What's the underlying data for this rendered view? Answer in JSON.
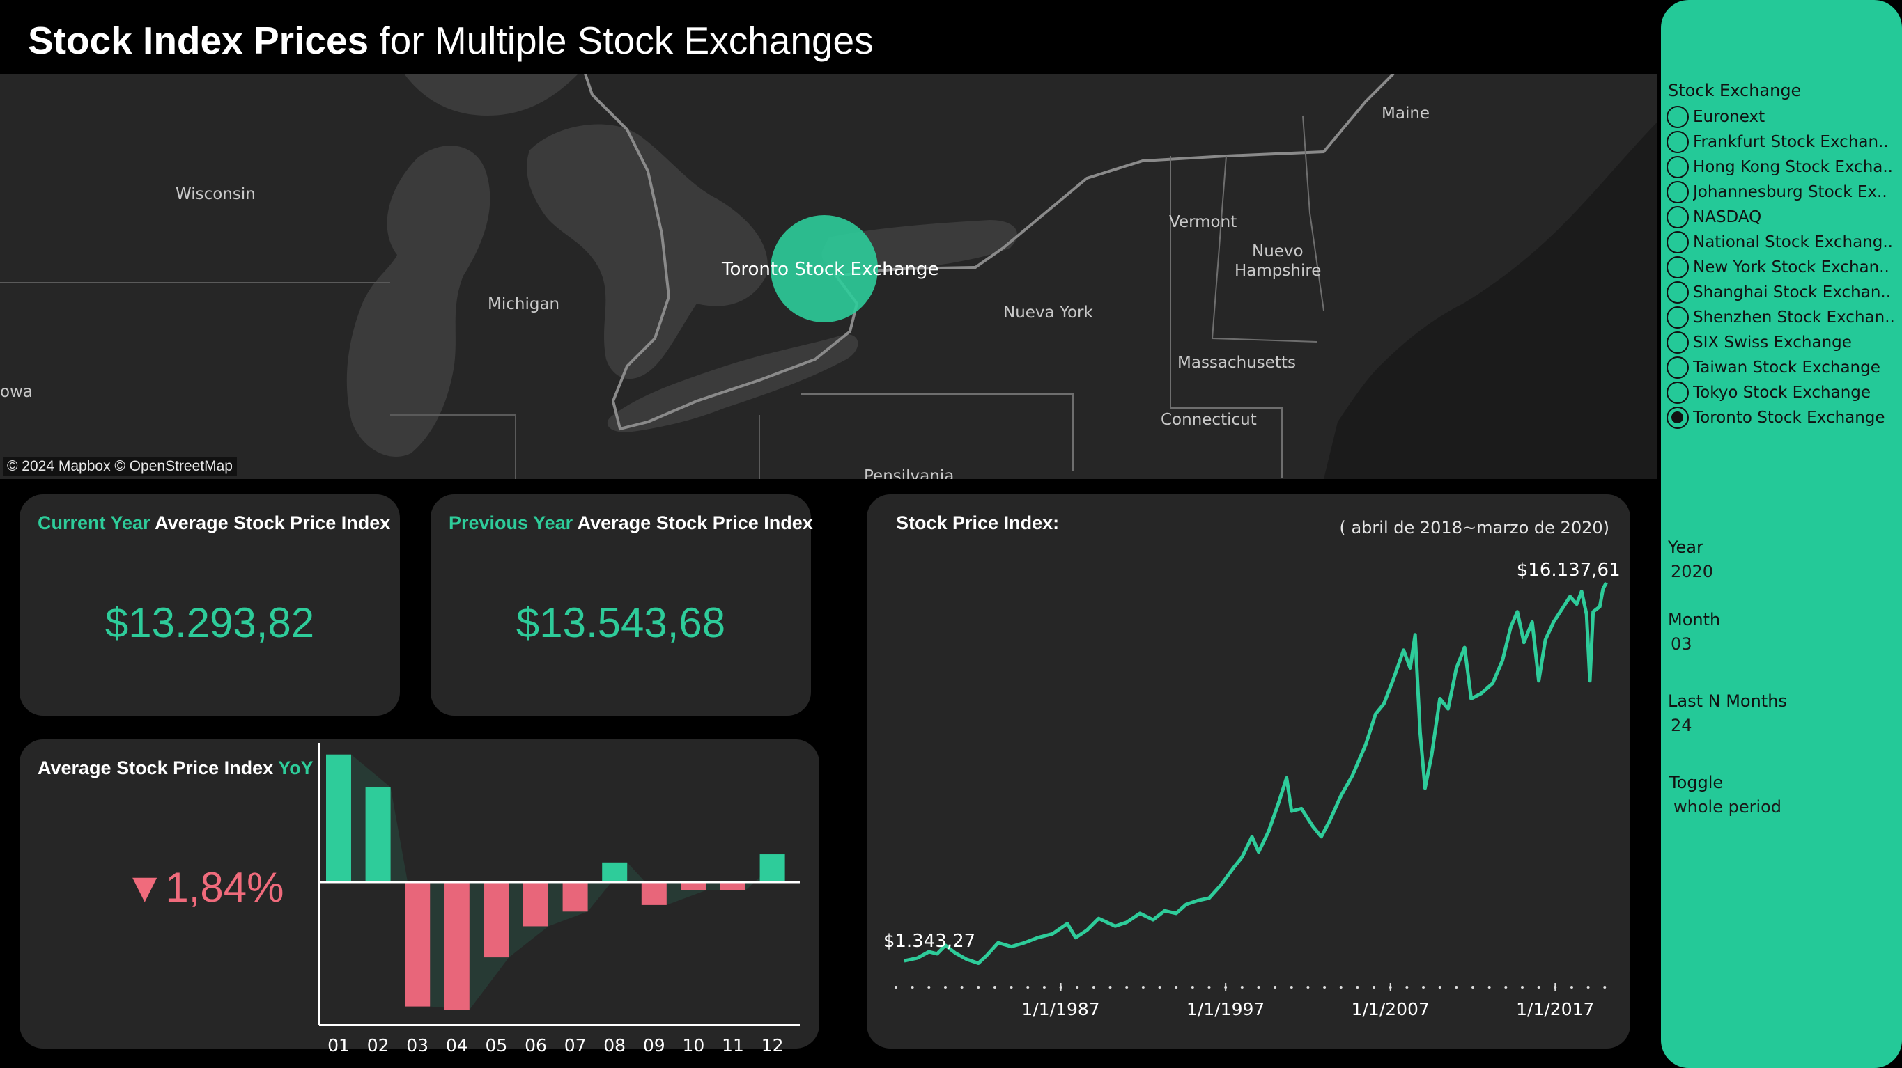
{
  "title": {
    "bold": "Stock Index Prices",
    "rest": "for Multiple Stock Exchanges"
  },
  "map": {
    "places": {
      "wisconsin": "Wisconsin",
      "michigan": "Michigan",
      "iowa": "owa",
      "maine": "Maine",
      "vermont": "Vermont",
      "nuevo_hampshire_1": "Nuevo",
      "nuevo_hampshire_2": "Hampshire",
      "nueva_york": "Nueva York",
      "massachusetts": "Massachusetts",
      "connecticut": "Connecticut",
      "pensilvania": "Pensilvania"
    },
    "marker_label": "Toronto Stock Exchange",
    "attribution": "© 2024 Mapbox © OpenStreetMap",
    "marker_color": "#2ecc9a"
  },
  "current_year_card": {
    "accent": "Current Year",
    "rest": "Average Stock Price Index",
    "value": "$13.293,82"
  },
  "previous_year_card": {
    "accent": "Previous Year",
    "rest": "Average Stock Price Index",
    "value": "$13.543,68"
  },
  "yoy_card": {
    "rest": "Average Stock Price Index",
    "accent": "YoY",
    "value": "▼1,84%"
  },
  "line_card": {
    "title": "Stock Price Index:",
    "subtitle": "( abril de 2018~marzo de 2020)",
    "start_label": "$1.343,27",
    "end_label": "$16.137,61"
  },
  "chart_data": [
    {
      "type": "bar",
      "categories": [
        "01",
        "02",
        "03",
        "04",
        "05",
        "06",
        "07",
        "08",
        "09",
        "10",
        "11",
        "12"
      ],
      "values": [
        7.8,
        5.8,
        -7.6,
        -7.8,
        -4.6,
        -2.7,
        -1.8,
        1.2,
        -1.4,
        -0.5,
        -0.5,
        1.7
      ],
      "colors": {
        "positive": "#2ecc9a",
        "negative": "#e8667a"
      }
    },
    {
      "type": "line",
      "x_ticks": [
        "1/1/1987",
        "1/1/1997",
        "1/1/2007",
        "1/1/2017"
      ],
      "x_range": [
        1977.0,
        2020.2
      ],
      "y_range": [
        800,
        16600
      ],
      "color": "#2ecc9a",
      "points": [
        [
          1977.5,
          1343.27
        ],
        [
          1978.3,
          1450
        ],
        [
          1979.0,
          1700
        ],
        [
          1979.5,
          1620
        ],
        [
          1980.0,
          1950
        ],
        [
          1980.6,
          1650
        ],
        [
          1981.3,
          1400
        ],
        [
          1982.0,
          1250
        ],
        [
          1982.5,
          1550
        ],
        [
          1983.2,
          2050
        ],
        [
          1984.0,
          1900
        ],
        [
          1984.8,
          2050
        ],
        [
          1985.6,
          2250
        ],
        [
          1986.5,
          2400
        ],
        [
          1987.4,
          2800
        ],
        [
          1987.9,
          2250
        ],
        [
          1988.6,
          2550
        ],
        [
          1989.3,
          3000
        ],
        [
          1990.3,
          2700
        ],
        [
          1991.0,
          2850
        ],
        [
          1991.8,
          3200
        ],
        [
          1992.6,
          2950
        ],
        [
          1993.3,
          3300
        ],
        [
          1994.0,
          3200
        ],
        [
          1994.6,
          3550
        ],
        [
          1995.3,
          3700
        ],
        [
          1996.0,
          3800
        ],
        [
          1996.7,
          4300
        ],
        [
          1997.5,
          5000
        ],
        [
          1998.0,
          5400
        ],
        [
          1998.6,
          6200
        ],
        [
          1999.0,
          5600
        ],
        [
          1999.6,
          6400
        ],
        [
          2000.2,
          7500
        ],
        [
          2000.7,
          8500
        ],
        [
          2001.0,
          7200
        ],
        [
          2001.6,
          7300
        ],
        [
          2002.3,
          6600
        ],
        [
          2002.8,
          6200
        ],
        [
          2003.3,
          6800
        ],
        [
          2004.0,
          7800
        ],
        [
          2004.7,
          8600
        ],
        [
          2005.5,
          9800
        ],
        [
          2006.1,
          11000
        ],
        [
          2006.6,
          11400
        ],
        [
          2007.2,
          12400
        ],
        [
          2007.8,
          13500
        ],
        [
          2008.2,
          12800
        ],
        [
          2008.5,
          14100
        ],
        [
          2008.8,
          10300
        ],
        [
          2009.1,
          8100
        ],
        [
          2009.5,
          9400
        ],
        [
          2010.0,
          11600
        ],
        [
          2010.5,
          11200
        ],
        [
          2011.0,
          12800
        ],
        [
          2011.5,
          13600
        ],
        [
          2011.9,
          11600
        ],
        [
          2012.5,
          11800
        ],
        [
          2013.2,
          12200
        ],
        [
          2013.8,
          13100
        ],
        [
          2014.3,
          14400
        ],
        [
          2014.7,
          15000
        ],
        [
          2015.1,
          13800
        ],
        [
          2015.6,
          14600
        ],
        [
          2016.0,
          12300
        ],
        [
          2016.4,
          13900
        ],
        [
          2016.9,
          14600
        ],
        [
          2017.4,
          15100
        ],
        [
          2017.9,
          15600
        ],
        [
          2018.3,
          15300
        ],
        [
          2018.6,
          15800
        ],
        [
          2018.9,
          14900
        ],
        [
          2019.1,
          12300
        ],
        [
          2019.3,
          15000
        ],
        [
          2019.7,
          15200
        ],
        [
          2019.9,
          15900
        ],
        [
          2020.1,
          16137.61
        ]
      ]
    }
  ],
  "filter_panel": {
    "exchange_label": "Stock Exchange",
    "exchanges": [
      "Euronext",
      "Frankfurt Stock Exchan..",
      "Hong Kong Stock Excha..",
      "Johannesburg Stock Ex..",
      "NASDAQ",
      "National Stock Exchang..",
      "New York Stock Exchan..",
      "Shanghai Stock Exchan..",
      "Shenzhen Stock Exchan..",
      "SIX Swiss Exchange",
      "Taiwan Stock Exchange",
      "Tokyo Stock Exchange",
      "Toronto Stock Exchange"
    ],
    "selected": "Toronto Stock Exchange",
    "year_label": "Year",
    "year_value": "2020",
    "month_label": "Month",
    "month_value": "03",
    "lastn_label": "Last N Months",
    "lastn_value": "24",
    "toggle_label": "Toggle",
    "toggle_value": "whole period"
  }
}
